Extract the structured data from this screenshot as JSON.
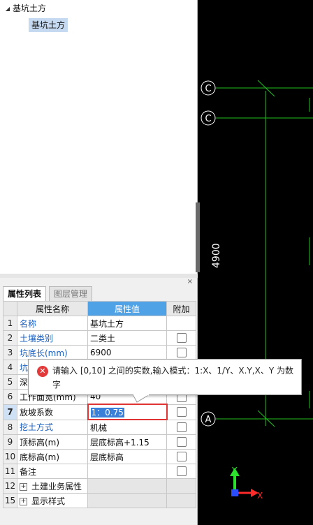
{
  "tree": {
    "root_label": "基坑土方",
    "child_label": "基坑土方"
  },
  "panel": {
    "close_label": "×",
    "tabs": [
      {
        "label": "属性列表",
        "active": true
      },
      {
        "label": "图层管理",
        "active": false
      }
    ],
    "columns": [
      "属性名称",
      "属性值",
      "附加"
    ],
    "rows": [
      {
        "num": "1",
        "name": "名称",
        "value": "基坑土方",
        "checkbox": false
      },
      {
        "num": "2",
        "name": "土壤类别",
        "value": "二类土",
        "checkbox": true
      },
      {
        "num": "3",
        "name": "坑底长(mm)",
        "value": "6900",
        "checkbox": true
      },
      {
        "num": "4",
        "name": "坑",
        "value": "",
        "checkbox": true
      },
      {
        "num": "5",
        "name": "深",
        "value": "",
        "checkbox": true
      },
      {
        "num": "6",
        "name": "工作面宽(mm)",
        "value": "40",
        "checkbox": true
      },
      {
        "num": "7",
        "name": "放坡系数",
        "value": "1：0.75",
        "checkbox": true
      },
      {
        "num": "8",
        "name": "挖土方式",
        "value": "机械",
        "checkbox": true
      },
      {
        "num": "9",
        "name": "顶标高(m)",
        "value": "层底标高+1.15",
        "checkbox": true
      },
      {
        "num": "10",
        "name": "底标高(m)",
        "value": "层底标高",
        "checkbox": true
      },
      {
        "num": "11",
        "name": "备注",
        "value": "",
        "checkbox": true
      },
      {
        "num": "12",
        "name": "土建业务属性",
        "value": "",
        "group": true
      },
      {
        "num": "15",
        "name": "显示样式",
        "value": "",
        "group": true
      }
    ]
  },
  "tooltip": {
    "icon": "error-icon",
    "line1": "请输入 [0,10] 之间的实数,输入模式：1:X、1/Y、X.Y,X、Y 为数",
    "line2": "字"
  },
  "cad": {
    "axis_labels": [
      "C",
      "C",
      "A"
    ],
    "dimension": "4900",
    "y_axis": "Y",
    "x_axis": "X",
    "colors": {
      "grid": "#1fbf1f",
      "axis_y": "#2ee02e",
      "axis_x": "#ff2a2a",
      "origin": "#2a4dff"
    }
  }
}
